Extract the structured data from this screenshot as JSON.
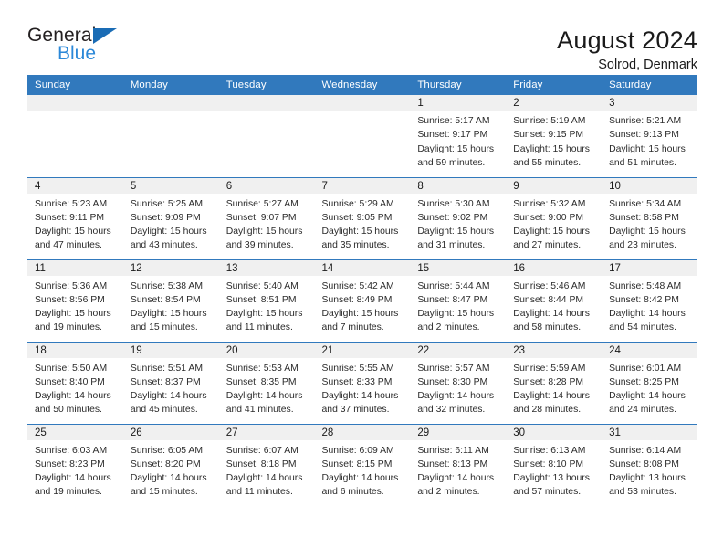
{
  "brand": {
    "name_part1": "General",
    "name_part2": "Blue",
    "triangle_icon": "blue-triangle-icon",
    "accent_color": "#2b88d8"
  },
  "header": {
    "title": "August 2024",
    "subtitle": "Solrod, Denmark"
  },
  "theme": {
    "header_row_bg": "#3179bd",
    "day_number_bg": "#f0f0f0",
    "grid_line": "#3179bd",
    "text": "#2b2b2b"
  },
  "calendar": {
    "weekday_headers": [
      "Sunday",
      "Monday",
      "Tuesday",
      "Wednesday",
      "Thursday",
      "Friday",
      "Saturday"
    ],
    "labels": {
      "sunrise": "Sunrise:",
      "sunset": "Sunset:",
      "daylight": "Daylight:"
    },
    "weeks": [
      [
        {
          "day": "",
          "blank": true
        },
        {
          "day": "",
          "blank": true
        },
        {
          "day": "",
          "blank": true
        },
        {
          "day": "",
          "blank": true
        },
        {
          "day": "1",
          "sunrise": "Sunrise: 5:17 AM",
          "sunset": "Sunset: 9:17 PM",
          "daylight": "Daylight: 15 hours and 59 minutes."
        },
        {
          "day": "2",
          "sunrise": "Sunrise: 5:19 AM",
          "sunset": "Sunset: 9:15 PM",
          "daylight": "Daylight: 15 hours and 55 minutes."
        },
        {
          "day": "3",
          "sunrise": "Sunrise: 5:21 AM",
          "sunset": "Sunset: 9:13 PM",
          "daylight": "Daylight: 15 hours and 51 minutes."
        }
      ],
      [
        {
          "day": "4",
          "sunrise": "Sunrise: 5:23 AM",
          "sunset": "Sunset: 9:11 PM",
          "daylight": "Daylight: 15 hours and 47 minutes."
        },
        {
          "day": "5",
          "sunrise": "Sunrise: 5:25 AM",
          "sunset": "Sunset: 9:09 PM",
          "daylight": "Daylight: 15 hours and 43 minutes."
        },
        {
          "day": "6",
          "sunrise": "Sunrise: 5:27 AM",
          "sunset": "Sunset: 9:07 PM",
          "daylight": "Daylight: 15 hours and 39 minutes."
        },
        {
          "day": "7",
          "sunrise": "Sunrise: 5:29 AM",
          "sunset": "Sunset: 9:05 PM",
          "daylight": "Daylight: 15 hours and 35 minutes."
        },
        {
          "day": "8",
          "sunrise": "Sunrise: 5:30 AM",
          "sunset": "Sunset: 9:02 PM",
          "daylight": "Daylight: 15 hours and 31 minutes."
        },
        {
          "day": "9",
          "sunrise": "Sunrise: 5:32 AM",
          "sunset": "Sunset: 9:00 PM",
          "daylight": "Daylight: 15 hours and 27 minutes."
        },
        {
          "day": "10",
          "sunrise": "Sunrise: 5:34 AM",
          "sunset": "Sunset: 8:58 PM",
          "daylight": "Daylight: 15 hours and 23 minutes."
        }
      ],
      [
        {
          "day": "11",
          "sunrise": "Sunrise: 5:36 AM",
          "sunset": "Sunset: 8:56 PM",
          "daylight": "Daylight: 15 hours and 19 minutes."
        },
        {
          "day": "12",
          "sunrise": "Sunrise: 5:38 AM",
          "sunset": "Sunset: 8:54 PM",
          "daylight": "Daylight: 15 hours and 15 minutes."
        },
        {
          "day": "13",
          "sunrise": "Sunrise: 5:40 AM",
          "sunset": "Sunset: 8:51 PM",
          "daylight": "Daylight: 15 hours and 11 minutes."
        },
        {
          "day": "14",
          "sunrise": "Sunrise: 5:42 AM",
          "sunset": "Sunset: 8:49 PM",
          "daylight": "Daylight: 15 hours and 7 minutes."
        },
        {
          "day": "15",
          "sunrise": "Sunrise: 5:44 AM",
          "sunset": "Sunset: 8:47 PM",
          "daylight": "Daylight: 15 hours and 2 minutes."
        },
        {
          "day": "16",
          "sunrise": "Sunrise: 5:46 AM",
          "sunset": "Sunset: 8:44 PM",
          "daylight": "Daylight: 14 hours and 58 minutes."
        },
        {
          "day": "17",
          "sunrise": "Sunrise: 5:48 AM",
          "sunset": "Sunset: 8:42 PM",
          "daylight": "Daylight: 14 hours and 54 minutes."
        }
      ],
      [
        {
          "day": "18",
          "sunrise": "Sunrise: 5:50 AM",
          "sunset": "Sunset: 8:40 PM",
          "daylight": "Daylight: 14 hours and 50 minutes."
        },
        {
          "day": "19",
          "sunrise": "Sunrise: 5:51 AM",
          "sunset": "Sunset: 8:37 PM",
          "daylight": "Daylight: 14 hours and 45 minutes."
        },
        {
          "day": "20",
          "sunrise": "Sunrise: 5:53 AM",
          "sunset": "Sunset: 8:35 PM",
          "daylight": "Daylight: 14 hours and 41 minutes."
        },
        {
          "day": "21",
          "sunrise": "Sunrise: 5:55 AM",
          "sunset": "Sunset: 8:33 PM",
          "daylight": "Daylight: 14 hours and 37 minutes."
        },
        {
          "day": "22",
          "sunrise": "Sunrise: 5:57 AM",
          "sunset": "Sunset: 8:30 PM",
          "daylight": "Daylight: 14 hours and 32 minutes."
        },
        {
          "day": "23",
          "sunrise": "Sunrise: 5:59 AM",
          "sunset": "Sunset: 8:28 PM",
          "daylight": "Daylight: 14 hours and 28 minutes."
        },
        {
          "day": "24",
          "sunrise": "Sunrise: 6:01 AM",
          "sunset": "Sunset: 8:25 PM",
          "daylight": "Daylight: 14 hours and 24 minutes."
        }
      ],
      [
        {
          "day": "25",
          "sunrise": "Sunrise: 6:03 AM",
          "sunset": "Sunset: 8:23 PM",
          "daylight": "Daylight: 14 hours and 19 minutes."
        },
        {
          "day": "26",
          "sunrise": "Sunrise: 6:05 AM",
          "sunset": "Sunset: 8:20 PM",
          "daylight": "Daylight: 14 hours and 15 minutes."
        },
        {
          "day": "27",
          "sunrise": "Sunrise: 6:07 AM",
          "sunset": "Sunset: 8:18 PM",
          "daylight": "Daylight: 14 hours and 11 minutes."
        },
        {
          "day": "28",
          "sunrise": "Sunrise: 6:09 AM",
          "sunset": "Sunset: 8:15 PM",
          "daylight": "Daylight: 14 hours and 6 minutes."
        },
        {
          "day": "29",
          "sunrise": "Sunrise: 6:11 AM",
          "sunset": "Sunset: 8:13 PM",
          "daylight": "Daylight: 14 hours and 2 minutes."
        },
        {
          "day": "30",
          "sunrise": "Sunrise: 6:13 AM",
          "sunset": "Sunset: 8:10 PM",
          "daylight": "Daylight: 13 hours and 57 minutes."
        },
        {
          "day": "31",
          "sunrise": "Sunrise: 6:14 AM",
          "sunset": "Sunset: 8:08 PM",
          "daylight": "Daylight: 13 hours and 53 minutes."
        }
      ]
    ]
  }
}
